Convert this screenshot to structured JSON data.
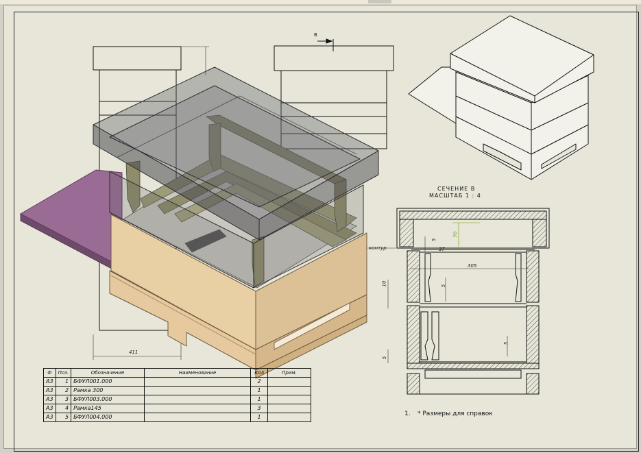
{
  "section": {
    "title": "СЕЧЕНИЕ В",
    "scale": "МАСШТАБ 1 : 4"
  },
  "view_marker": "B",
  "dimensions": {
    "width_411": "411",
    "height_70": "70",
    "width_305": "305",
    "gap_5a": "5",
    "gap_5b": "5",
    "gap_5c": "5",
    "gap_5d": "5",
    "offset_37": "37",
    "height_10": "10",
    "kontur": "контур"
  },
  "bom": {
    "headers": [
      "Ф",
      "Поз.",
      "Обозначение",
      "Наименование",
      "Кол",
      "Прим."
    ],
    "rows": [
      {
        "format": "А3",
        "pos": "1",
        "designation": "БФУЛ001.000",
        "name": "",
        "qty": "2",
        "note": ""
      },
      {
        "format": "А3",
        "pos": "2",
        "designation": "Рамка 300",
        "name": "",
        "qty": "1",
        "note": ""
      },
      {
        "format": "А3",
        "pos": "3",
        "designation": "БФУЛ003.000",
        "name": "",
        "qty": "1",
        "note": ""
      },
      {
        "format": "А3",
        "pos": "4",
        "designation": "Рамка145",
        "name": "",
        "qty": "3",
        "note": ""
      },
      {
        "format": "А3",
        "pos": "5",
        "designation": "БФУЛ004.000",
        "name": "",
        "qty": "1",
        "note": ""
      }
    ]
  },
  "note": {
    "number": "1.",
    "text": "* Размеры для справок"
  },
  "colors": {
    "paper": "#e7e6d9",
    "wood": "#e8c89a",
    "board": "#9a6c95",
    "glass": "#5a5a60",
    "dim_accent": "#6aa000"
  }
}
